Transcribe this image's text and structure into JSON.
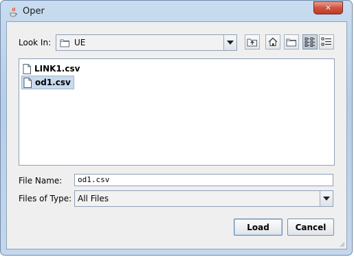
{
  "window": {
    "title": "Oper",
    "close_symbol": "✕"
  },
  "look_in": {
    "label": "Look In:",
    "value": "UE",
    "icon": "folder-icon"
  },
  "toolbar": {
    "buttons": [
      {
        "name": "up-one-level-button",
        "icon": "folder-up-icon"
      },
      {
        "name": "home-button",
        "icon": "home-icon"
      },
      {
        "name": "new-folder-button",
        "icon": "new-folder-icon"
      },
      {
        "name": "list-view-button",
        "icon": "list-view-icon",
        "active": true
      },
      {
        "name": "details-view-button",
        "icon": "details-view-icon"
      }
    ]
  },
  "files": [
    {
      "name": "LINK1.csv",
      "selected": false
    },
    {
      "name": "od1.csv",
      "selected": true
    }
  ],
  "file_name": {
    "label": "File Name:",
    "value": "od1.csv"
  },
  "files_of_type": {
    "label": "Files of Type:",
    "value": "All Files"
  },
  "actions": {
    "load_label": "Load",
    "cancel_label": "Cancel"
  },
  "colors": {
    "selection": "#c9daee",
    "close_button": "#c94a37",
    "dialog_background": "#efefef"
  }
}
